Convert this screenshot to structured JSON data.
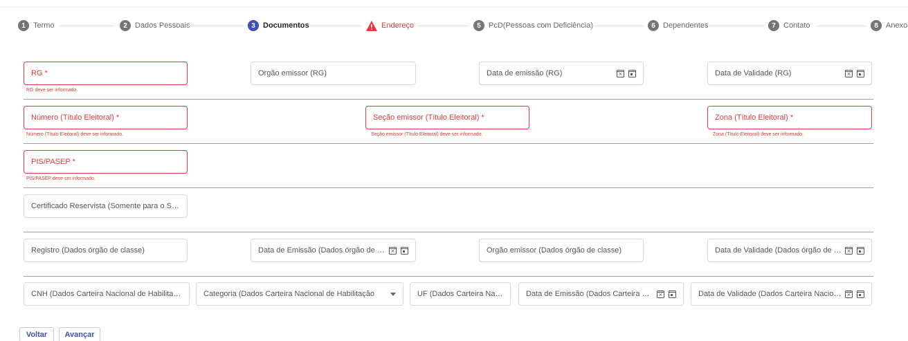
{
  "stepper": {
    "steps": [
      {
        "num": "1",
        "label": "Termo"
      },
      {
        "num": "2",
        "label": "Dados Pessoais"
      },
      {
        "num": "3",
        "label": "Documentos"
      },
      {
        "num": "",
        "label": "Endereço"
      },
      {
        "num": "5",
        "label": "PcD(Pessoas com Deficiência)"
      },
      {
        "num": "6",
        "label": "Dependentes"
      },
      {
        "num": "7",
        "label": "Contato"
      },
      {
        "num": "8",
        "label": "Anexos"
      }
    ]
  },
  "form": {
    "rg": {
      "label": "RG *",
      "error": "RG deve ser informado."
    },
    "orgao_rg": {
      "label": "Orgão emissor (RG)"
    },
    "data_emissao_rg": {
      "label": "Data de emissão (RG)"
    },
    "data_validade_rg": {
      "label": "Data de Validade (RG)"
    },
    "titulo_numero": {
      "label": "Número (Título Eleitoral) *",
      "error": "Número (Título Eleitoral) deve ser informado."
    },
    "titulo_secao": {
      "label": "Seção emissor (Título Eleitoral) *",
      "error": "Seção emissor (Título Eleitoral) deve ser informado."
    },
    "titulo_zona": {
      "label": "Zona (Título Eleitoral) *",
      "error": "Zona (Título Eleitoral) deve ser informado."
    },
    "pis": {
      "label": "PIS/PASEP *",
      "error": "PIS/PASEP deve ser informado."
    },
    "reservista": {
      "label": "Certificado Reservista (Somente para o Sexo M..."
    },
    "registro_classe": {
      "label": "Registro (Dados órgão de classe)"
    },
    "data_emissao_classe": {
      "label": "Data de Emissão (Dados órgão de classe)"
    },
    "orgao_classe": {
      "label": "Orgão emissor (Dados órgão de classe)"
    },
    "data_validade_classe": {
      "label": "Data de Validade (Dados órgão de classe)"
    },
    "cnh": {
      "label": "CNH (Dados Carteira Nacional de Habilitação)"
    },
    "categoria_cnh": {
      "label": "Categoria (Dados Carteira Nacional de Habilitação"
    },
    "uf_cnh": {
      "label": "UF (Dados Carteira Nacion..."
    },
    "data_emissao_cnh": {
      "label": "Data de Emissão (Dados Carteira Nacional"
    },
    "data_validade_cnh": {
      "label": "Data de Validade (Dados Carteira Nacional de"
    }
  },
  "buttons": {
    "back": "Voltar",
    "next": "Avançar"
  },
  "colors": {
    "primary": "#3f51b5",
    "error": "#e53935"
  }
}
